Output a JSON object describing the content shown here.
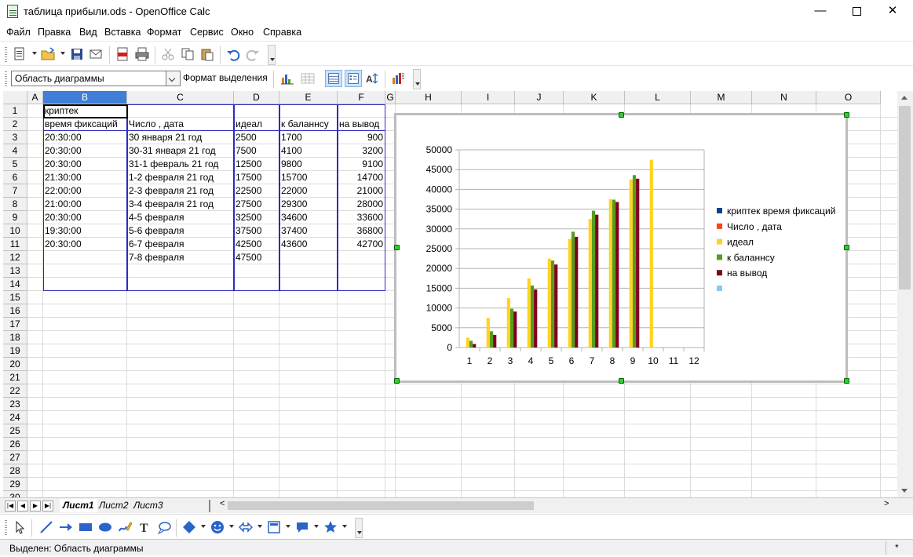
{
  "window": {
    "title": "таблица прибыли.ods - OpenOffice Calc",
    "minimize": "—",
    "close": "✕"
  },
  "menu": [
    "Файл",
    "Правка",
    "Вид",
    "Вставка",
    "Формат",
    "Сервис",
    "Окно",
    "Справка"
  ],
  "toolbar2": {
    "chart_element": "Область диаграммы",
    "format_selection": "Формат выделения"
  },
  "grid": {
    "columns": [
      "A",
      "B",
      "C",
      "D",
      "E",
      "F",
      "G",
      "H",
      "I",
      "J",
      "K",
      "L",
      "M",
      "N",
      "O"
    ],
    "selected_column": "B",
    "rows": [
      "1",
      "2",
      "3",
      "4",
      "5",
      "6",
      "7",
      "8",
      "9",
      "10",
      "11",
      "12",
      "13",
      "14",
      "15",
      "16",
      "17",
      "18",
      "19",
      "20",
      "21",
      "22",
      "23",
      "24",
      "25",
      "26",
      "27",
      "28",
      "29",
      "30"
    ],
    "cells": {
      "B1": "криптек",
      "B2": "время фиксаций",
      "C2": "Число , дата",
      "D2": "идеал",
      "E2": "к баланнсу",
      "F2": "на вывод",
      "B": [
        "20:30:00",
        "20:30:00",
        "20:30:00",
        "21:30:00",
        "22:00:00",
        "21:00:00",
        "20:30:00",
        "19:30:00",
        "20:30:00"
      ],
      "C": [
        "30 января 21 год",
        "30-31 января 21 год",
        "31-1 февраль 21 год",
        "1-2 февраля 21 год",
        "2-3 февраля 21 год",
        "3-4 февраля 21 год",
        "4-5 февраля",
        "5-6 февраля",
        "6-7 февраля",
        "7-8 февраля"
      ],
      "D": [
        "2500",
        "7500",
        "12500",
        "17500",
        "22500",
        "27500",
        "32500",
        "37500",
        "42500",
        "47500"
      ],
      "E": [
        "1700",
        "4100",
        "9800",
        "15700",
        "22000",
        "29300",
        "34600",
        "37400",
        "43600"
      ],
      "F": [
        "900",
        "3200",
        "9100",
        "14700",
        "21000",
        "28000",
        "33600",
        "36800",
        "42700"
      ]
    }
  },
  "sheets": [
    "Лист1",
    "Лист2",
    "Лист3"
  ],
  "active_sheet": "Лист1",
  "status": {
    "text": "Выделен: Область диаграммы",
    "modified": "*"
  },
  "chart_data": {
    "type": "bar",
    "categories": [
      "1",
      "2",
      "3",
      "4",
      "5",
      "6",
      "7",
      "8",
      "9",
      "10",
      "11",
      "12"
    ],
    "ylim": [
      0,
      50000
    ],
    "yticks": [
      "0",
      "5000",
      "10000",
      "15000",
      "20000",
      "25000",
      "30000",
      "35000",
      "40000",
      "45000",
      "50000"
    ],
    "grid": true,
    "legend_position": "right",
    "series": [
      {
        "name": "криптек время фиксаций",
        "color": "#004586",
        "values": []
      },
      {
        "name": "Число , дата",
        "color": "#ff420e",
        "values": []
      },
      {
        "name": "идеал",
        "color": "#ffd320",
        "values": [
          2500,
          7500,
          12500,
          17500,
          22500,
          27500,
          32500,
          37500,
          42500,
          47500
        ]
      },
      {
        "name": "к баланнсу",
        "color": "#579d1c",
        "values": [
          1700,
          4100,
          9800,
          15700,
          22000,
          29300,
          34600,
          37400,
          43600
        ]
      },
      {
        "name": "на вывод",
        "color": "#7e0021",
        "values": [
          900,
          3200,
          9100,
          14700,
          21000,
          28000,
          33600,
          36800,
          42700
        ]
      },
      {
        "name": "",
        "color": "#83caff",
        "values": []
      }
    ]
  }
}
